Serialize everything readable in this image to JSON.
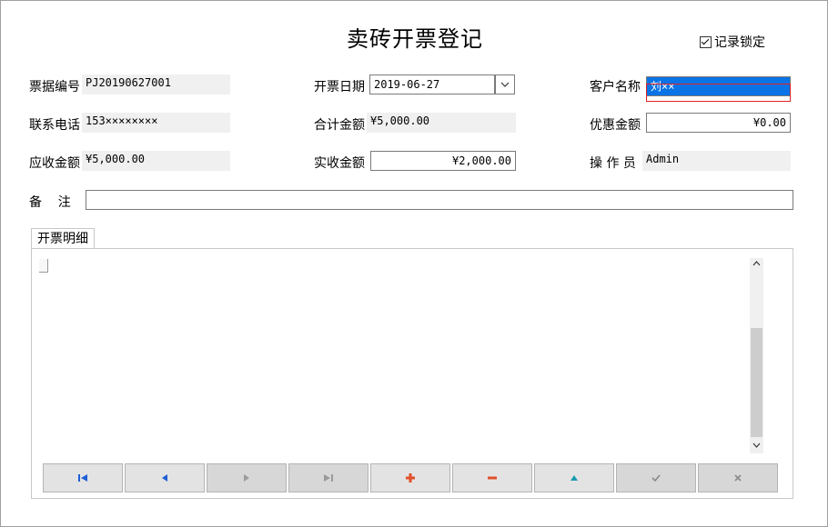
{
  "title": "卖砖开票登记",
  "record_lock": {
    "label": "记录锁定",
    "checked": true
  },
  "fields": {
    "bill_no": {
      "label": "票据编号",
      "value": "PJ20190627001"
    },
    "bill_date": {
      "label": "开票日期",
      "value": "2019-06-27"
    },
    "customer": {
      "label": "客户名称",
      "value": "刘××"
    },
    "phone": {
      "label": "联系电话",
      "value": "153××××××××"
    },
    "total_amount": {
      "label": "合计金额",
      "value": "¥5,000.00"
    },
    "discount": {
      "label": "优惠金额",
      "value": "¥0.00"
    },
    "receivable": {
      "label": "应收金额",
      "value": "¥5,000.00"
    },
    "received": {
      "label": "实收金额",
      "value": "¥2,000.00"
    },
    "operator": {
      "label": "操 作 员",
      "value": "Admin"
    },
    "remark": {
      "label": "备    注",
      "value": ""
    }
  },
  "tabs": [
    {
      "label": "开票明细"
    }
  ],
  "navigator": [
    {
      "name": "first",
      "icon": "first-record-icon",
      "color": "#1f5fd6"
    },
    {
      "name": "prior",
      "icon": "prior-record-icon",
      "color": "#1f5fd6"
    },
    {
      "name": "next",
      "icon": "next-record-icon",
      "color": "#9a9a9a"
    },
    {
      "name": "last",
      "icon": "last-record-icon",
      "color": "#9a9a9a"
    },
    {
      "name": "insert",
      "icon": "plus-icon",
      "color": "#e0502a"
    },
    {
      "name": "delete",
      "icon": "minus-icon",
      "color": "#e0502a"
    },
    {
      "name": "edit",
      "icon": "edit-triangle-icon",
      "color": "#1a9bb0"
    },
    {
      "name": "post",
      "icon": "check-icon",
      "color": "#8a8a8a"
    },
    {
      "name": "cancel",
      "icon": "cancel-x-icon",
      "color": "#8a8a8a"
    }
  ],
  "colors": {
    "selection": "#0a73e6",
    "focus_border": "#e02020"
  }
}
